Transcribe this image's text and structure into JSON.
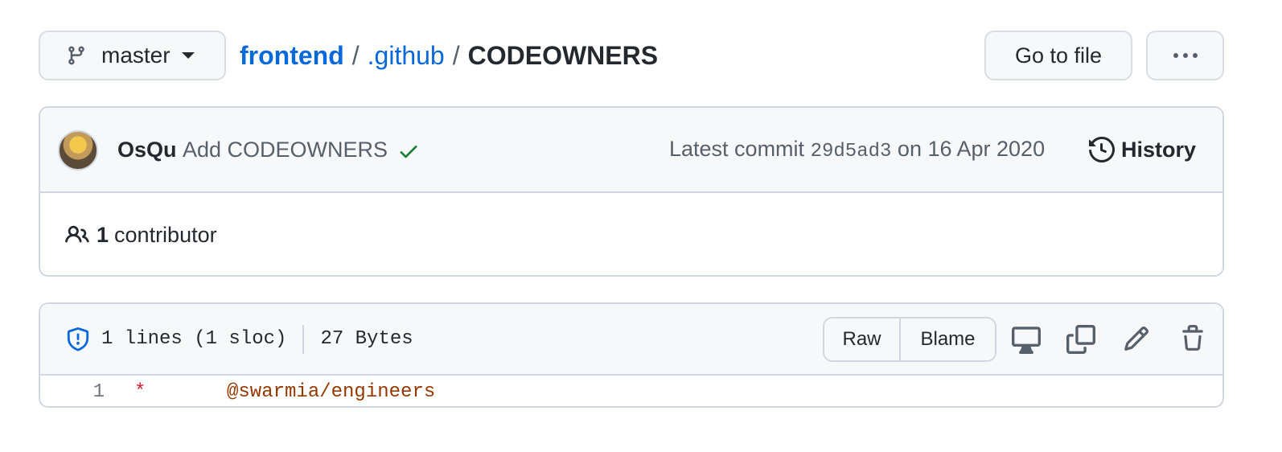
{
  "branch": {
    "name": "master",
    "icon": "git-branch-icon"
  },
  "breadcrumb": {
    "repo": "frontend",
    "sep1": "/",
    "dir": ".github",
    "sep2": "/",
    "file": "CODEOWNERS"
  },
  "actions": {
    "go_to_file": "Go to file",
    "more_icon": "kebab-horizontal-icon"
  },
  "commit": {
    "author": "OsQu",
    "message": "Add CODEOWNERS",
    "status": "success",
    "latest_prefix": "Latest commit",
    "sha": "29d5ad3",
    "date_text": "on 16 Apr 2020",
    "history_label": "History"
  },
  "contributors": {
    "count": "1",
    "label": "contributor"
  },
  "file": {
    "lines_info": "1 lines (1 sloc)",
    "size": "27 Bytes",
    "raw_label": "Raw",
    "blame_label": "Blame",
    "tools": [
      "display-icon",
      "copy-icon",
      "pencil-icon",
      "trash-icon"
    ]
  },
  "code": [
    {
      "line": "1",
      "pattern": "*",
      "owner": "@swarmia/engineers"
    }
  ],
  "colors": {
    "link": "#0969da",
    "success": "#1a7f37",
    "border": "#d0d7de",
    "header_bg": "#f6f8fa"
  }
}
